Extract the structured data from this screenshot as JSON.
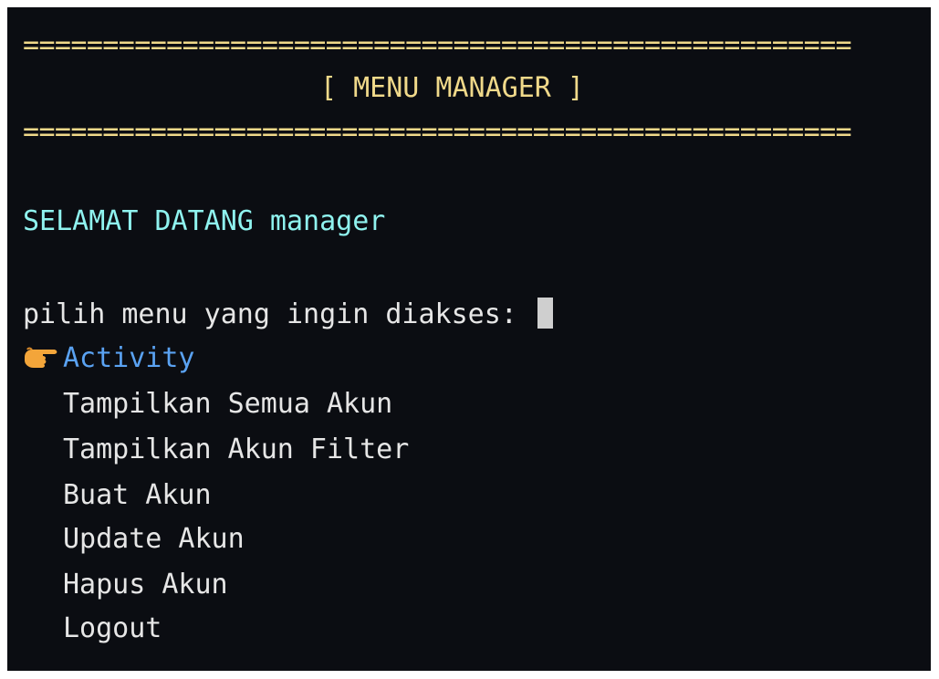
{
  "header": {
    "rule_top": "====================================================",
    "title": "[ MENU MANAGER ]",
    "rule_bottom": "===================================================="
  },
  "welcome": "SELAMAT DATANG manager",
  "prompt": "pilih menu yang ingin diakses:",
  "menu": {
    "selected_icon": "pointing-hand-icon",
    "items": [
      {
        "label": "Activity",
        "selected": true
      },
      {
        "label": "Tampilkan Semua Akun",
        "selected": false
      },
      {
        "label": "Tampilkan Akun Filter",
        "selected": false
      },
      {
        "label": "Buat Akun",
        "selected": false
      },
      {
        "label": "Update Akun",
        "selected": false
      },
      {
        "label": "Hapus Akun",
        "selected": false
      },
      {
        "label": "Logout",
        "selected": false
      }
    ]
  },
  "colors": {
    "background": "#0b0d12",
    "rule": "#f0d98a",
    "welcome": "#8ff3ef",
    "selected": "#5aa2f2",
    "text": "#e6e6e6"
  }
}
